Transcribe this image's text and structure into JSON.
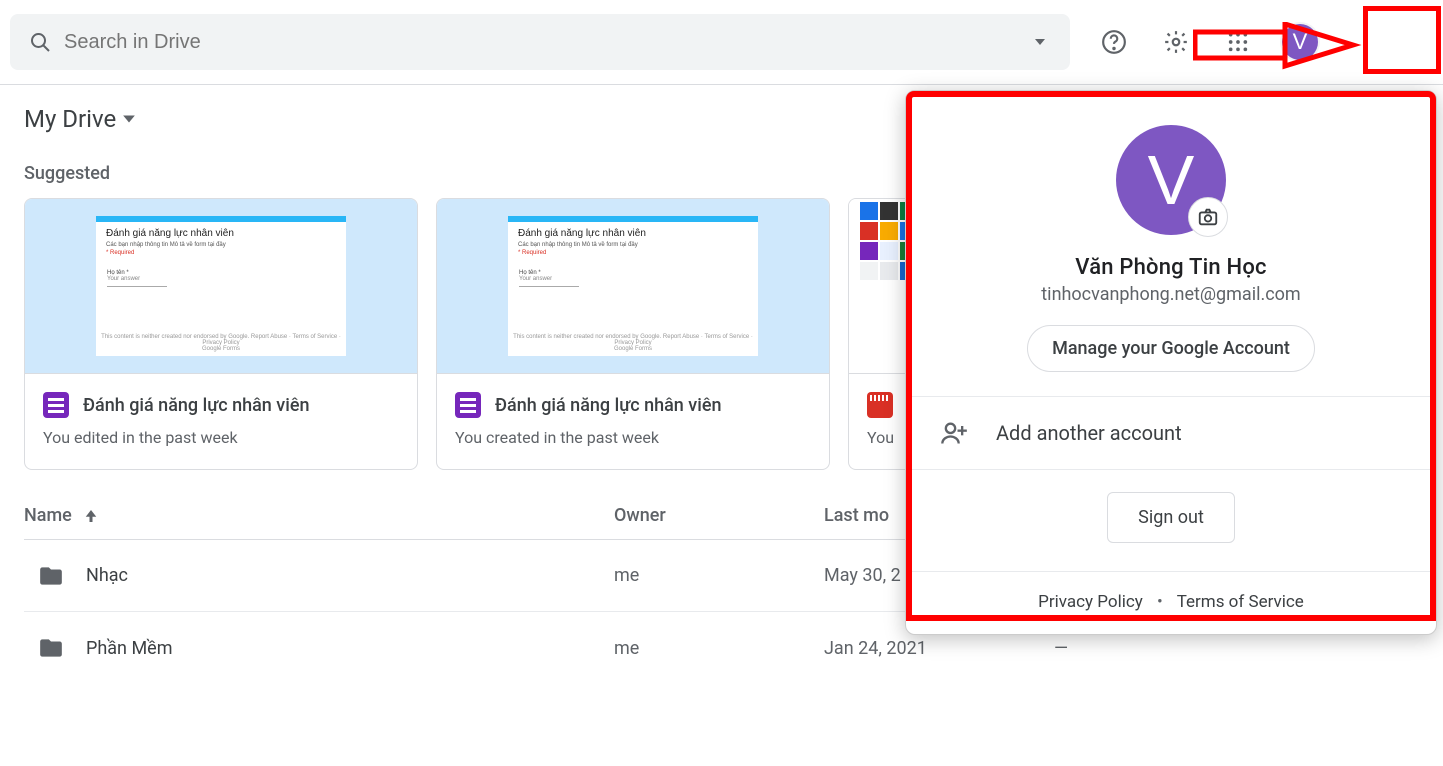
{
  "topbar": {
    "search_placeholder": "Search in Drive",
    "avatar_letter": "V"
  },
  "breadcrumb": {
    "label": "My Drive"
  },
  "suggested": {
    "label": "Suggested",
    "cards": [
      {
        "thumb_title": "Đánh giá năng lực nhân viên",
        "thumb_sub": "Các bạn nhập thông tin Mô tả về form tại đây",
        "thumb_required": "* Required",
        "thumb_field": "Họ tên *",
        "thumb_answer": "Your answer",
        "thumb_footer1": "This content is neither created nor endorsed by Google. Report Abuse · Terms of Service · Privacy Policy",
        "thumb_footer2": "Google Forms",
        "title": "Đánh giá năng lực nhân viên",
        "subtitle": "You edited in the past week",
        "icon": "forms"
      },
      {
        "thumb_title": "Đánh giá năng lực nhân viên",
        "thumb_sub": "Các bạn nhập thông tin Mô tả về form tại đây",
        "thumb_required": "* Required",
        "thumb_field": "Họ tên *",
        "thumb_answer": "Your answer",
        "thumb_footer1": "This content is neither created nor endorsed by Google. Report Abuse · Terms of Service · Privacy Policy",
        "thumb_footer2": "Google Forms",
        "title": "Đánh giá năng lực nhân viên",
        "subtitle": "You created in the past week",
        "icon": "forms"
      },
      {
        "title": "",
        "subtitle": "You",
        "icon": "video"
      }
    ]
  },
  "table": {
    "headers": {
      "name": "Name",
      "owner": "Owner",
      "last_modified": "Last mo",
      "size": ""
    },
    "rows": [
      {
        "name": "Nhạc",
        "owner": "me",
        "modified": "May 30, 2",
        "size": ""
      },
      {
        "name": "Phần Mềm",
        "owner": "me",
        "modified": "Jan 24, 2021",
        "size": "—"
      }
    ]
  },
  "popup": {
    "avatar_letter": "V",
    "name": "Văn Phòng Tin Học",
    "email": "tinhocvanphong.net@gmail.com",
    "manage_label": "Manage your Google Account",
    "add_account_label": "Add another account",
    "signout_label": "Sign out",
    "privacy_label": "Privacy Policy",
    "terms_label": "Terms of Service"
  }
}
